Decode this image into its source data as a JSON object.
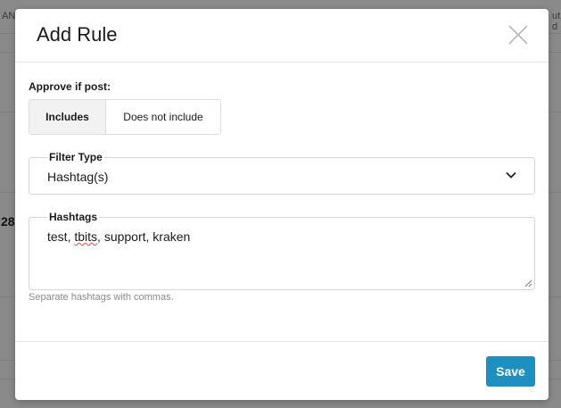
{
  "background": {
    "text_left": "AN",
    "text_right": "ut d",
    "number": "28"
  },
  "modal": {
    "title": "Add Rule",
    "close_icon": "close-icon"
  },
  "approve": {
    "label": "Approve if post:",
    "options": [
      "Includes",
      "Does not include"
    ],
    "selected": "Includes"
  },
  "filter_type": {
    "label": "Filter Type",
    "value": "Hashtag(s)",
    "icon": "chevron-down-icon"
  },
  "hashtags": {
    "label": "Hashtags",
    "value_parts": [
      "test, ",
      "tbits",
      ", support, kraken"
    ],
    "helper": "Separate hashtags with commas."
  },
  "footer": {
    "save_label": "Save",
    "save_color": "#1e90c0"
  }
}
